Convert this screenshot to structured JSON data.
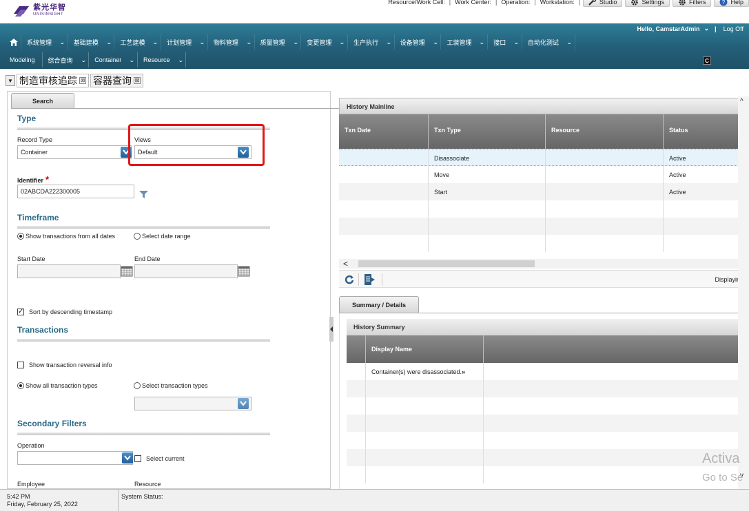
{
  "header": {
    "logo_cn": "紫光华智",
    "logo_en": "UNISINSIGHT",
    "crumbs": [
      "Resource/Work Cell:",
      "Work Center:",
      "Operation:",
      "Workstation:"
    ],
    "buttons": {
      "studio": "Studio",
      "settings": "Settings",
      "filters": "Filters",
      "help": "Help"
    }
  },
  "nav": {
    "greeting": "Hello, CamstarAdmin",
    "logoff": "Log Off",
    "menu1": [
      "系统管理",
      "基础建模",
      "工艺建模",
      "计划管理",
      "物料管理",
      "质量管理",
      "变更管理",
      "生产执行",
      "设备管理",
      "工装管理",
      "接口",
      "自动化测试"
    ],
    "menu2": [
      "Modeling",
      "综合查询",
      "Container",
      "Resource"
    ],
    "corner_badge": "C"
  },
  "tabs": [
    {
      "label": "制造审核追踪",
      "close": "⊠"
    },
    {
      "label": "容器查询",
      "close": "⊠"
    }
  ],
  "search": {
    "tab_label": "Search",
    "type_section": "Type",
    "record_type_label": "Record Type",
    "record_type_value": "Container",
    "views_label": "Views",
    "views_value": "Default",
    "identifier_label": "Identifier",
    "identifier_required": "*",
    "identifier_value": "02ABCDA222300005",
    "timeframe_section": "Timeframe",
    "radio_all_dates": "Show transactions from all dates",
    "radio_date_range": "Select date range",
    "start_date_label": "Start Date",
    "end_date_label": "End Date",
    "sort_desc_label": "Sort by descending timestamp",
    "transactions_section": "Transactions",
    "reversal_label": "Show transaction reversal info",
    "radio_all_types": "Show all transaction types",
    "radio_select_types": "Select transaction types",
    "secondary_section": "Secondary Filters",
    "operation_label": "Operation",
    "select_current_label": "Select current",
    "employee_label": "Employee",
    "resource_label": "Resource"
  },
  "mainline": {
    "title": "History Mainline",
    "columns": [
      "Txn Date",
      "Txn Type",
      "Resource",
      "Status"
    ],
    "rows": [
      {
        "date": "",
        "type": "Disassociate",
        "resource": "",
        "status": "Active"
      },
      {
        "date": "",
        "type": "Move",
        "resource": "",
        "status": "Active"
      },
      {
        "date": "",
        "type": "Start",
        "resource": "",
        "status": "Active"
      }
    ],
    "display_info": "Displayir",
    "scroll_left": "<"
  },
  "summary": {
    "tab_label": "Summary / Details",
    "title": "History Summary",
    "column": "Display Name",
    "rows": [
      "Container(s) were disassociated."
    ],
    "expand_glyph": "»"
  },
  "watermark": {
    "line1": "Activa",
    "line2": "Go to Se"
  },
  "status": {
    "time": "5:42 PM",
    "date": "Friday, February 25, 2022",
    "system_status": "System Status:"
  }
}
